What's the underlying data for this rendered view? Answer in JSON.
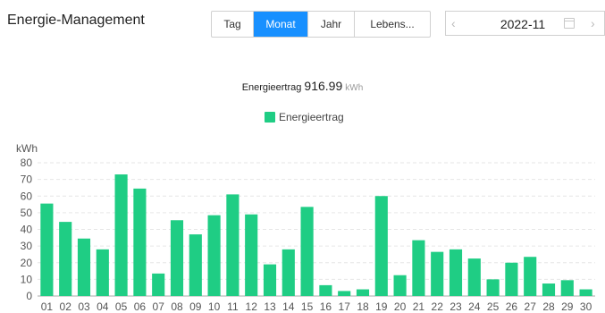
{
  "header": {
    "title": "Energie-Management",
    "tabs": [
      {
        "label": "Tag",
        "active": false
      },
      {
        "label": "Monat",
        "active": true
      },
      {
        "label": "Jahr",
        "active": false
      },
      {
        "label": "Lebens...",
        "active": false
      }
    ],
    "date_value": "2022-11",
    "prev_icon": "chevron-left-icon",
    "next_icon": "chevron-right-icon",
    "calendar_icon": "calendar-icon"
  },
  "summary": {
    "label": "Energieertrag",
    "value": "916.99",
    "unit": "kWh"
  },
  "colors": {
    "bar": "#1fcd84",
    "accent": "#1890ff",
    "grid": "#e6e6e6",
    "axis": "#999999"
  },
  "chart_data": {
    "type": "bar",
    "title": "",
    "ylabel": "kWh",
    "xlabel": "",
    "legend": "top-center",
    "grid": true,
    "ylim": [
      0,
      80
    ],
    "yticks": [
      0,
      10,
      20,
      30,
      40,
      50,
      60,
      70,
      80
    ],
    "categories": [
      "01",
      "02",
      "03",
      "04",
      "05",
      "06",
      "07",
      "08",
      "09",
      "10",
      "11",
      "12",
      "13",
      "14",
      "15",
      "16",
      "17",
      "18",
      "19",
      "20",
      "21",
      "22",
      "23",
      "24",
      "25",
      "26",
      "27",
      "28",
      "29",
      "30"
    ],
    "series": [
      {
        "name": "Energieertrag",
        "values": [
          55.5,
          44.5,
          34.5,
          28,
          73,
          64.5,
          13.5,
          45.5,
          37,
          48.5,
          61,
          49,
          19,
          28,
          53.5,
          6.5,
          3,
          4,
          60,
          12.5,
          33.5,
          26.5,
          28,
          22.5,
          10,
          20,
          23.5,
          7.5,
          9.5,
          4
        ]
      }
    ]
  }
}
